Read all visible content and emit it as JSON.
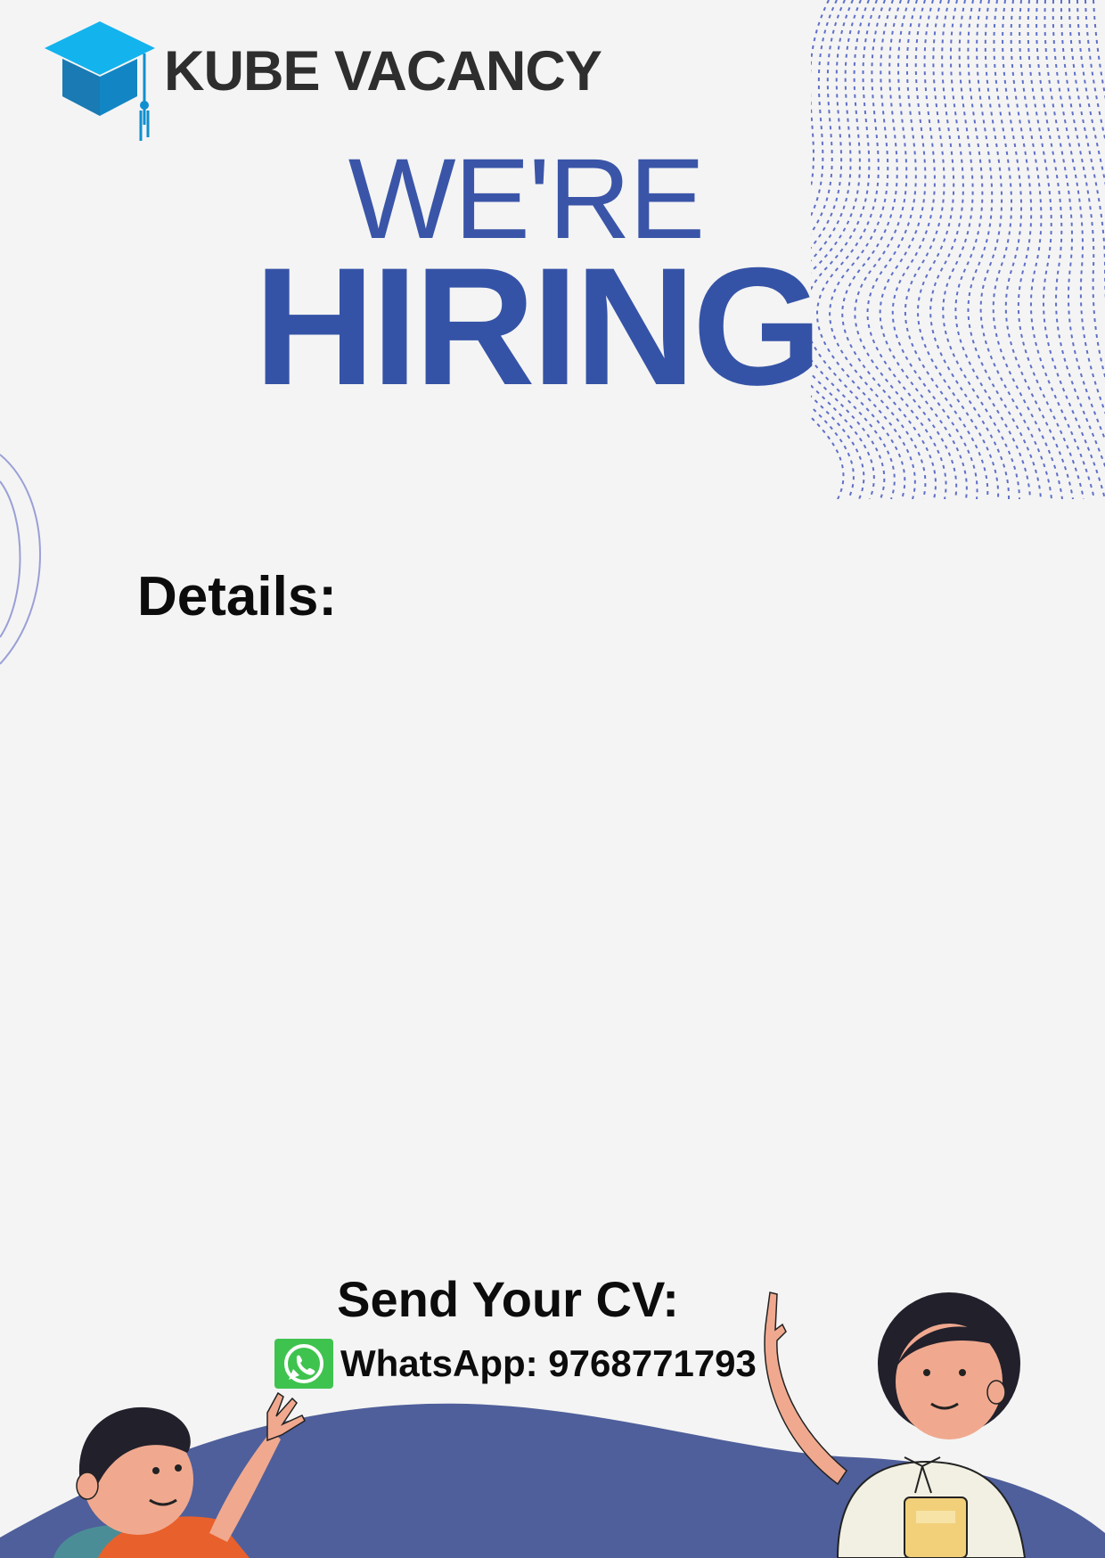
{
  "brand": {
    "name": "KUBE VACANCY",
    "logo_icon": "graduation-cap-icon"
  },
  "headline": {
    "line1": "WE'RE",
    "line2": "HIRING"
  },
  "details": {
    "label": "Details:"
  },
  "contact": {
    "heading": "Send Your CV:",
    "whatsapp_text": "WhatsApp: 9768771793",
    "whatsapp_icon": "whatsapp-icon"
  },
  "colors": {
    "headline_blue": "#3553a6",
    "wave_blue": "#4f5f9b",
    "logo_cyan": "#12a7e6",
    "whatsapp_green": "#3fc34f"
  }
}
